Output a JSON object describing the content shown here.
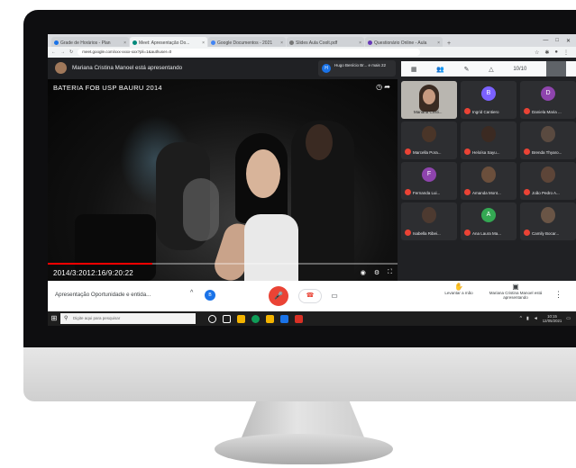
{
  "browser": {
    "tabs": [
      {
        "label": "Grade de Horários - Plan",
        "active": false
      },
      {
        "label": "Meet: Apresentação Do...",
        "active": true
      },
      {
        "label": "Google Documentos - 2021",
        "active": false
      },
      {
        "label": "Slides Aula Coolt.pdf",
        "active": false
      },
      {
        "label": "Questionário Online - Aula",
        "active": false
      }
    ],
    "new_tab": "+",
    "url": "meet.google.com/xxx-xxxx-xxx?pli=1&authuser=0"
  },
  "meet": {
    "presenting_text": "Mariana Cristina Manoel está apresentando",
    "top_tile_initial": "H",
    "top_tile_name": "Hugo Benício Br... e mais 22",
    "participant_count": "10/10",
    "video": {
      "title": "BATERIA FOB USP BAURU 2014",
      "time": "2014/3:2012:16/9:20:22",
      "progress_percent": 30
    },
    "participants": [
      {
        "name": "Mariana Cristi...",
        "initial": "",
        "color": "#b9b6b0",
        "self": true
      },
      {
        "name": "Ingrid Cantiero",
        "initial": "B",
        "color": "#7b61ff"
      },
      {
        "name": "Daniela Maria ...",
        "initial": "D",
        "color": "#8e44ad"
      },
      {
        "name": "Marcella Pora...",
        "initial": "",
        "color": "#4a3528"
      },
      {
        "name": "Heloísa Sayu...",
        "initial": "",
        "color": "#3b2a22"
      },
      {
        "name": "Brenda Thyaro...",
        "initial": "",
        "color": "#5a4a40"
      },
      {
        "name": "Fernanda Lui...",
        "initial": "F",
        "color": "#8e44ad"
      },
      {
        "name": "Amanda Mont...",
        "initial": "",
        "color": "#6b4f3c"
      },
      {
        "name": "João Pedro A...",
        "initial": "",
        "color": "#5d4538"
      },
      {
        "name": "Isabella Ribei...",
        "initial": "",
        "color": "#4d3a30"
      },
      {
        "name": "Ana Laura Ma...",
        "initial": "A",
        "color": "#34a853"
      },
      {
        "name": "Camily Bocar...",
        "initial": "",
        "color": "#6a5546"
      }
    ],
    "bottom": {
      "presentation_label": "Apresentação Oportunidade e entida...",
      "presenter_initial": "B",
      "raise_hand": "Levantar a mão",
      "presenting_now": "Mariana Cristina Manoel está apresentando"
    }
  },
  "taskbar": {
    "search_placeholder": "Digite aqui para pesquisar",
    "time": "10:15",
    "date": "12/05/2021"
  }
}
